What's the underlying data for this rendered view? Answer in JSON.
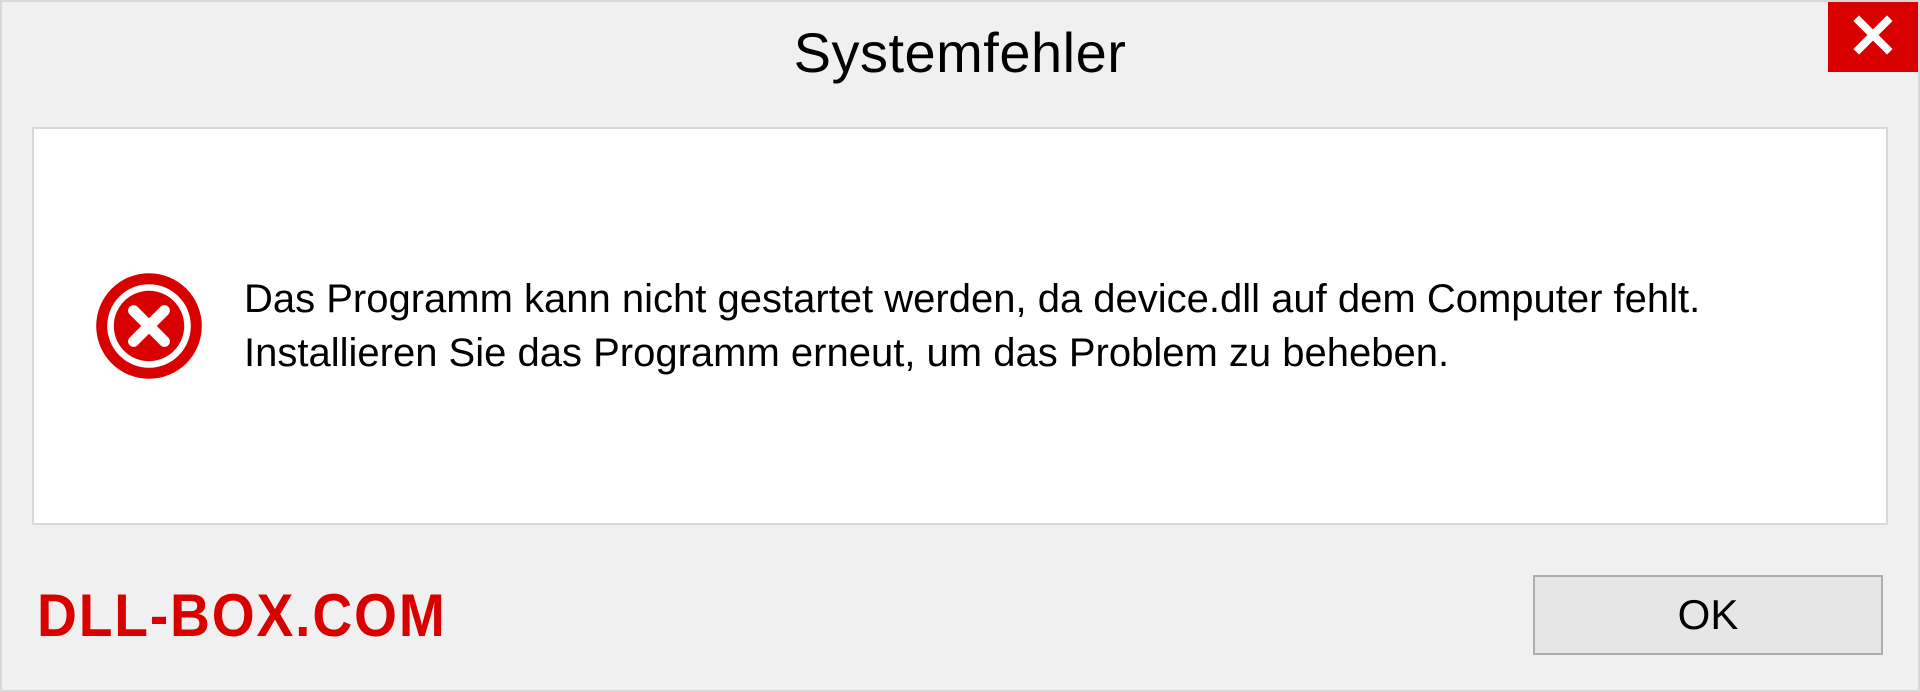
{
  "dialog": {
    "title": "Systemfehler",
    "message": "Das Programm kann nicht gestartet werden, da device.dll auf dem Computer fehlt. Installieren Sie das Programm erneut, um das Problem zu beheben.",
    "ok_label": "OK"
  },
  "watermark": "DLL-BOX.COM",
  "colors": {
    "accent": "#d90000",
    "panel": "#f0f0f0",
    "border": "#d8d8d8"
  }
}
